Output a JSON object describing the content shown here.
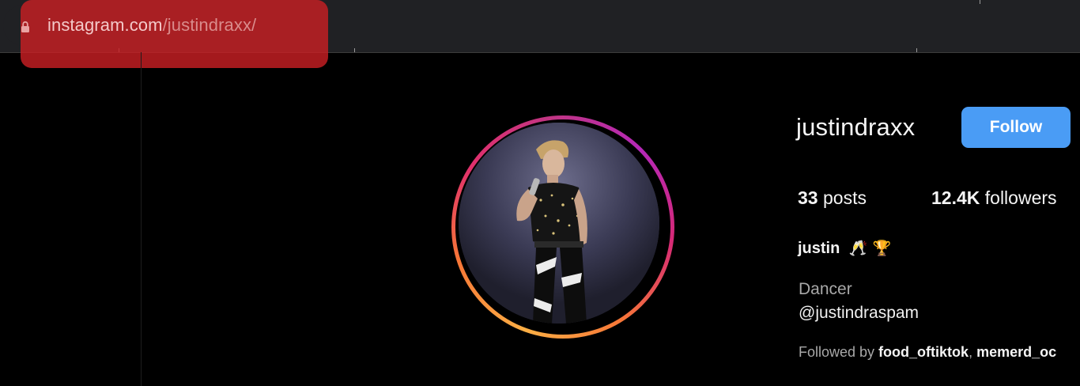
{
  "browser": {
    "url_domain": "instagram.com",
    "url_path": "/justindraxx/",
    "lock_icon": "lock-icon"
  },
  "profile": {
    "username": "justindraxx",
    "follow_label": "Follow",
    "follow_color": "#4a9cf5",
    "posts_count": "33",
    "posts_label": "posts",
    "followers_count": "12.4K",
    "followers_label": "followers",
    "full_name": "justin",
    "name_emojis": [
      "🥂",
      "🏆"
    ],
    "category": "Dancer",
    "bio_handle": "@justindraspam",
    "followed_by_label": "Followed by",
    "followed_by_users": [
      "food_oftiktok",
      "memerd_oc"
    ],
    "followed_by_separator": ", "
  },
  "colors": {
    "page_background": "#000000",
    "url_highlight": "#c81e23",
    "story_ring": [
      "#fcaf45",
      "#f77737",
      "#e1306c",
      "#c13584"
    ]
  }
}
